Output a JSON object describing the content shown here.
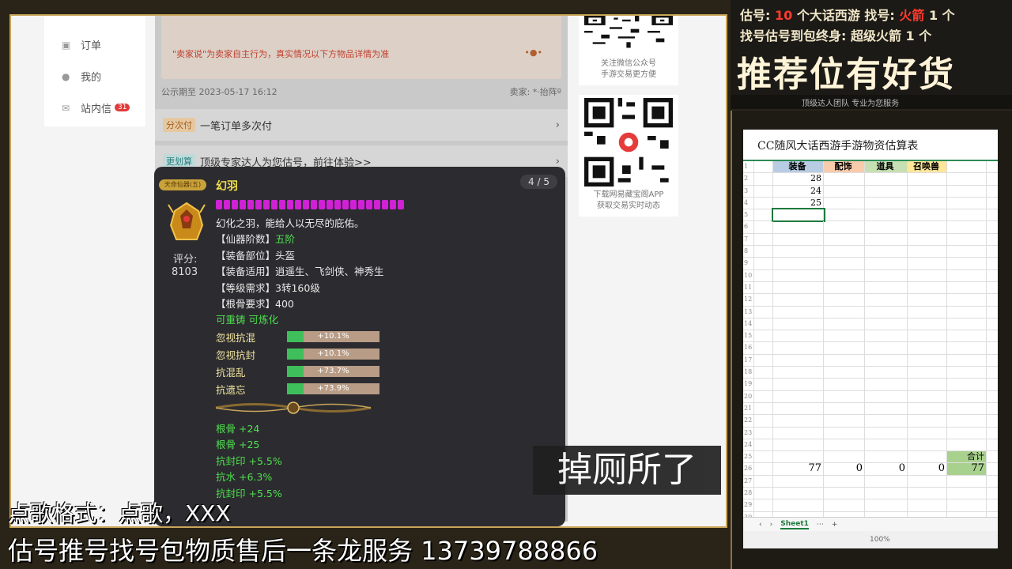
{
  "sidebar": {
    "items": [
      {
        "label": "订单",
        "icon": "receipt-icon"
      },
      {
        "label": "我的",
        "icon": "user-icon"
      },
      {
        "label": "站内信",
        "icon": "mail-icon",
        "badge": "31"
      }
    ]
  },
  "listing": {
    "note_text": "\"卖家说\"为卖家自主行为，真实情况以下方物品详情为准",
    "publicity": "公示期至 2023-05-17 16:12",
    "seller": "卖家: *·抬阵º",
    "rows": [
      {
        "tag": "分次付",
        "text": "一笔订单多次付"
      },
      {
        "tag": "更划算",
        "text": "顶级专家达人为您估号，前往体验>>"
      }
    ]
  },
  "qr_cards": [
    {
      "caption1": "关注微信公众号",
      "caption2": "手游交易更方便"
    },
    {
      "caption1": "下载网易藏宝阁APP",
      "caption2": "获取交易实时动态"
    }
  ],
  "item_tooltip": {
    "pager": "4 / 5",
    "badge": "天命仙器(五)",
    "name": "幻羽",
    "star_count": 24,
    "score_label": "评分:",
    "score_value": "8103",
    "desc": "幻化之羽，能给人以无尽的庇佑。",
    "attrs": [
      {
        "k": "【仙器阶数】",
        "v": "五阶",
        "green": true
      },
      {
        "k": "【装备部位】",
        "v": "头盔"
      },
      {
        "k": "【装备适用】",
        "v": "逍遥生、飞剑侠、神秀生"
      },
      {
        "k": "【等级需求】",
        "v": "3转160级"
      },
      {
        "k": "【根骨要求】",
        "v": "400"
      }
    ],
    "recast": "可重铸 可炼化",
    "stats": [
      {
        "label": "忽视抗混",
        "value": "+10.1%",
        "fill": 0.101
      },
      {
        "label": "忽视抗封",
        "value": "+10.1%",
        "fill": 0.101
      },
      {
        "label": "抗混乱",
        "value": "+73.7%",
        "fill": 0.101
      },
      {
        "label": "抗遗忘",
        "value": "+73.9%",
        "fill": 0.101
      }
    ],
    "extra_lines": [
      "根骨 +24",
      "根骨 +25",
      "抗封印 +5.5%",
      "抗水 +6.3%",
      "抗封印 +5.5%"
    ]
  },
  "overlay": {
    "line1_pre": "估号: ",
    "line1_num": "10",
    "line1_mid": " 个大话西游  找号: ",
    "line1_red": "火箭",
    "line1_post": " 1 个",
    "line2_pre": "找号估号到包终身: ",
    "line2_post": " 超级火箭 1 个",
    "big": "推荐位有好货",
    "sub": "顶级达人团队  专业为您服务"
  },
  "spreadsheet": {
    "title": "CC随风大话西游手游物资估算表",
    "headers": [
      "装备",
      "配饰",
      "道具",
      "召唤兽",
      ""
    ],
    "rows": [
      [
        "28",
        "",
        "",
        "",
        ""
      ],
      [
        "24",
        "",
        "",
        "",
        ""
      ],
      [
        "25",
        "",
        "",
        "",
        ""
      ]
    ],
    "total_label": "合计",
    "totals": [
      "77",
      "0",
      "0",
      "0",
      "77"
    ],
    "sheet_tab": "Sheet1",
    "zoom": "100%"
  },
  "captions": {
    "afk": "掉厕所了",
    "song": "点歌格式：点歌，XXX",
    "service": "估号推号找号包物质售后一条龙服务 13739788866"
  },
  "colors": {
    "star": "#d021d6",
    "stat_fill": "#3fbf5b",
    "stat_track": "#b89c86",
    "gold_border": "#c9a55a"
  }
}
